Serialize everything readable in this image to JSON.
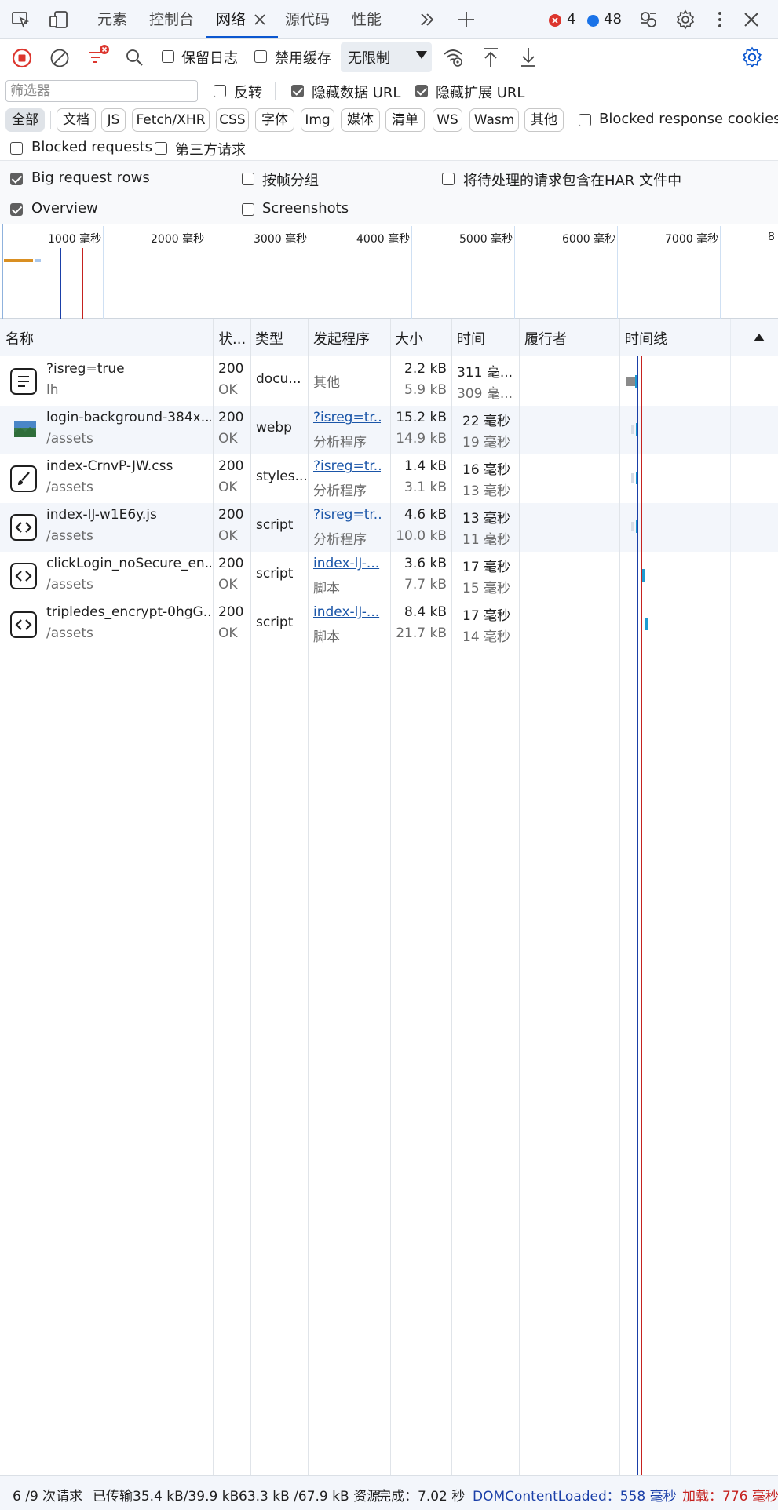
{
  "tabs": {
    "elements": "元素",
    "console": "控制台",
    "network": "网络",
    "sources": "源代码",
    "performance": "性能",
    "error_count": "4",
    "message_count": "48"
  },
  "toolbar": {
    "preserve_log": "保留日志",
    "disable_cache": "禁用缓存",
    "throttling": "无限制"
  },
  "filter": {
    "placeholder": "筛选器",
    "invert": "反转",
    "hide_data_urls": "隐藏数据 URL",
    "hide_extension_urls": "隐藏扩展 URL",
    "types": [
      "全部",
      "文档",
      "JS",
      "Fetch/XHR",
      "CSS",
      "字体",
      "Img",
      "媒体",
      "清单",
      "WS",
      "Wasm",
      "其他"
    ],
    "blocked_response_cookies": "Blocked response cookies",
    "blocked_requests": "Blocked requests",
    "third_party": "第三方请求"
  },
  "options": {
    "big_request_rows": "Big request rows",
    "group_by_frame": "按帧分组",
    "include_pending_har": "将待处理的请求包含在HAR 文件中",
    "overview": "Overview",
    "screenshots": "Screenshots"
  },
  "overview_ticks": [
    "1000 毫秒",
    "2000 毫秒",
    "3000 毫秒",
    "4000 毫秒",
    "5000 毫秒",
    "6000 毫秒",
    "7000 毫秒",
    "8"
  ],
  "columns": [
    "名称",
    "状...",
    "类型",
    "发起程序",
    "大小",
    "时间",
    "履行者",
    "时间线"
  ],
  "rows": [
    {
      "name": "?isreg=true",
      "path": "lh",
      "status": "200",
      "status_text": "OK",
      "type": "docu...",
      "initiator": "其他",
      "initiator_sub": "",
      "size": "2.2 kB",
      "size_sub": "5.9 kB",
      "time": "311 毫...",
      "time_sub": "309 毫...",
      "icon": "document-icon"
    },
    {
      "name": "login-background-384x...",
      "path": "/assets",
      "status": "200",
      "status_text": "OK",
      "type": "webp",
      "initiator": "?isreg=tr...",
      "initiator_sub": "分析程序",
      "size": "15.2 kB",
      "size_sub": "14.9 kB",
      "time": "22 毫秒",
      "time_sub": "19 毫秒",
      "icon": "image-icon"
    },
    {
      "name": "index-CrnvP-JW.css",
      "path": "/assets",
      "status": "200",
      "status_text": "OK",
      "type": "styles...",
      "initiator": "?isreg=tr...",
      "initiator_sub": "分析程序",
      "size": "1.4 kB",
      "size_sub": "3.1 kB",
      "time": "16 毫秒",
      "time_sub": "13 毫秒",
      "icon": "stylesheet-icon"
    },
    {
      "name": "index-lJ-w1E6y.js",
      "path": "/assets",
      "status": "200",
      "status_text": "OK",
      "type": "script",
      "initiator": "?isreg=tr...",
      "initiator_sub": "分析程序",
      "size": "4.6 kB",
      "size_sub": "10.0 kB",
      "time": "13 毫秒",
      "time_sub": "11 毫秒",
      "icon": "script-icon"
    },
    {
      "name": "clickLogin_noSecure_en...",
      "path": "/assets",
      "status": "200",
      "status_text": "OK",
      "type": "script",
      "initiator": "index-lJ-...",
      "initiator_sub": "脚本",
      "size": "3.6 kB",
      "size_sub": "7.7 kB",
      "time": "17 毫秒",
      "time_sub": "15 毫秒",
      "icon": "script-icon"
    },
    {
      "name": "tripledes_encrypt-0hgG...",
      "path": "/assets",
      "status": "200",
      "status_text": "OK",
      "type": "script",
      "initiator": "index-lJ-...",
      "initiator_sub": "脚本",
      "size": "8.4 kB",
      "size_sub": "21.7 kB",
      "time": "17 毫秒",
      "time_sub": "14 毫秒",
      "icon": "script-icon"
    }
  ],
  "status": {
    "requests": "6 /9 次请求",
    "transferred": "已传输35.4 kB/39.9 kB",
    "resources": "63.3 kB /67.9 kB 资源",
    "finish": "完成：7.02 秒",
    "dcl": "DOMContentLoaded：558 毫秒",
    "load": "加载：776 毫秒"
  },
  "colors": {
    "accent": "#0b57d0",
    "dcl": "#1a3fa8",
    "load": "#c5221f",
    "error": "#dc362e"
  }
}
